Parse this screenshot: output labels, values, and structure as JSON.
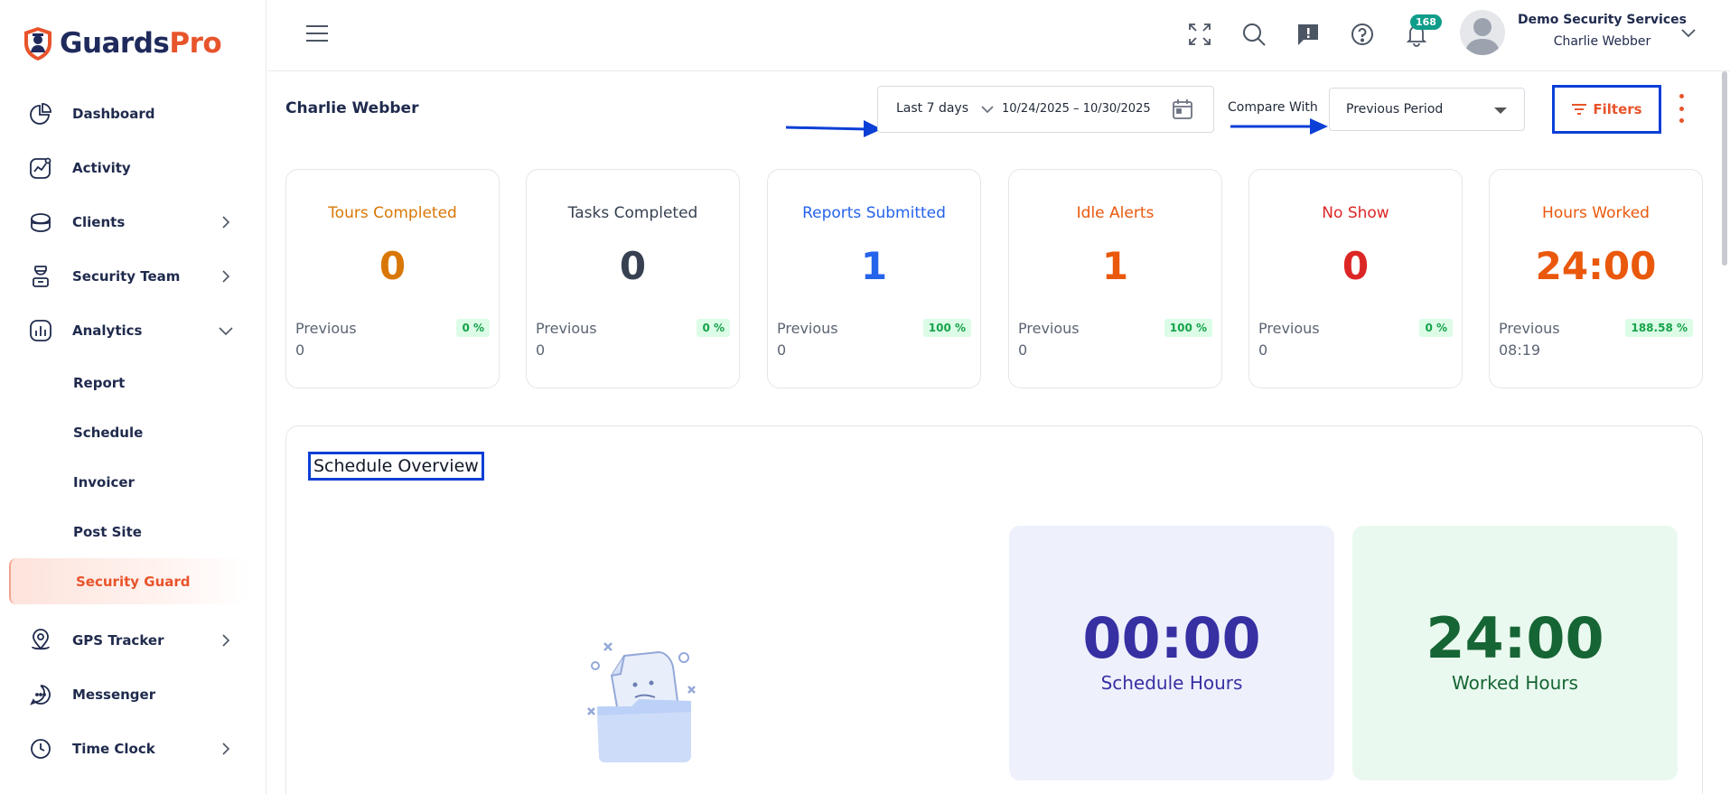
{
  "brand": {
    "part1": "Guards",
    "part2": "Pro"
  },
  "sidebar": {
    "items": [
      {
        "label": "Dashboard",
        "icon": "pie-chart-icon",
        "has_arrow": false
      },
      {
        "label": "Activity",
        "icon": "activity-chart-icon",
        "has_arrow": false
      },
      {
        "label": "Clients",
        "icon": "clients-icon",
        "has_arrow": true
      },
      {
        "label": "Security Team",
        "icon": "guard-icon",
        "has_arrow": true
      },
      {
        "label": "Analytics",
        "icon": "analytics-icon",
        "expanded": true
      }
    ],
    "analytics_sub": [
      "Report",
      "Schedule",
      "Invoicer",
      "Post Site",
      "Security Guard"
    ],
    "active_sub": "Security Guard",
    "bottom_items": [
      {
        "label": "GPS Tracker",
        "icon": "location-pin-icon",
        "has_arrow": true
      },
      {
        "label": "Messenger",
        "icon": "chat-bubble-icon",
        "has_arrow": false
      },
      {
        "label": "Time Clock",
        "icon": "clock-icon",
        "has_arrow": true
      }
    ]
  },
  "header": {
    "notification_count": "168",
    "company": "Demo Security Services",
    "user_name": "Charlie Webber"
  },
  "page": {
    "title": "Charlie Webber",
    "date_range": "Last 7 days",
    "date_text": "10/24/2025 – 10/30/2025",
    "compare_label": "Compare With",
    "compare_value": "Previous Period",
    "filters_label": "Filters"
  },
  "stats": [
    {
      "title": "Tours Completed",
      "value": "0",
      "prev_label": "Previous",
      "prev_value": "0",
      "pct": "0 %",
      "color": "#d97706"
    },
    {
      "title": "Tasks Completed",
      "value": "0",
      "prev_label": "Previous",
      "prev_value": "0",
      "pct": "0 %",
      "color": "#374151"
    },
    {
      "title": "Reports Submitted",
      "value": "1",
      "prev_label": "Previous",
      "prev_value": "0",
      "pct": "100 %",
      "color": "#2563eb"
    },
    {
      "title": "Idle Alerts",
      "value": "1",
      "prev_label": "Previous",
      "prev_value": "0",
      "pct": "100 %",
      "color": "#ea580c"
    },
    {
      "title": "No Show",
      "value": "0",
      "prev_label": "Previous",
      "prev_value": "0",
      "pct": "0 %",
      "color": "#dc2626"
    },
    {
      "title": "Hours Worked",
      "value": "24:00",
      "prev_label": "Previous",
      "prev_value": "08:19",
      "pct": "188.58 %",
      "color": "#ea580c"
    }
  ],
  "schedule": {
    "title": "Schedule Overview",
    "schedule_hours": "00:00",
    "schedule_hours_label": "Schedule Hours",
    "worked_hours": "24:00",
    "worked_hours_label": "Worked Hours",
    "schedule_color": "#3730a3",
    "worked_color": "#166534"
  }
}
